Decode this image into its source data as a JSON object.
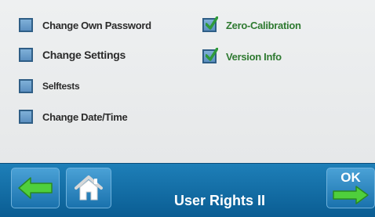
{
  "options": {
    "change_own_password": {
      "label": "Change Own Password",
      "checked": false
    },
    "change_settings": {
      "label": "Change Settings",
      "checked": false
    },
    "selftests": {
      "label": "Selftests",
      "checked": false
    },
    "change_date_time": {
      "label": "Change Date/Time",
      "checked": false
    },
    "zero_calibration": {
      "label": "Zero-Calibration",
      "checked": true
    },
    "version_info": {
      "label": "Version Info",
      "checked": true
    }
  },
  "footer": {
    "title": "User Rights II",
    "ok_label": "OK",
    "back_icon": "arrow-left-icon",
    "home_icon": "home-icon",
    "ok_icon": "arrow-right-icon"
  },
  "colors": {
    "accent_blue": "#0a5d93",
    "check_green": "#2f9a3a",
    "arrow_green": "#4fcf3c"
  }
}
